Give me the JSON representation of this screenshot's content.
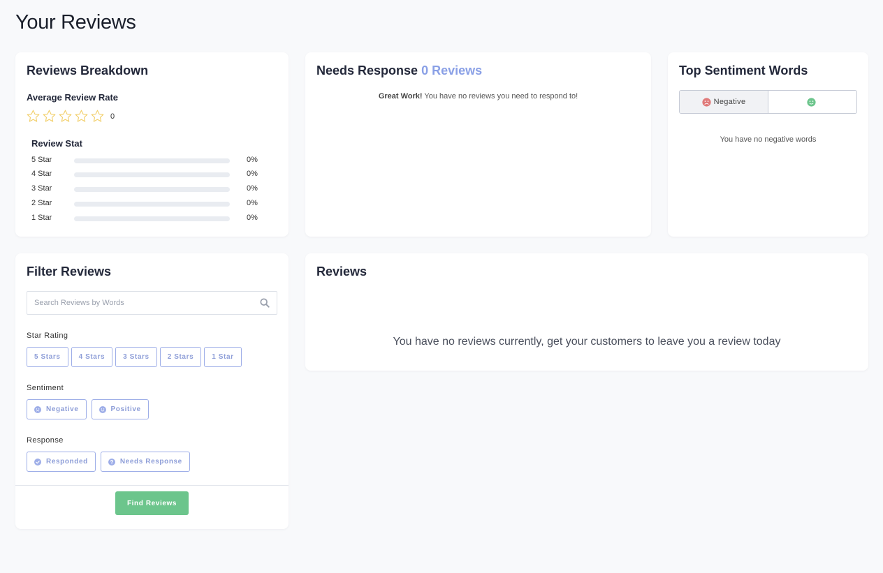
{
  "page": {
    "title": "Your Reviews"
  },
  "colors": {
    "accent": "#8aa0e6",
    "chip_border": "#9eaee8",
    "green": "#6cc58c",
    "star_outline": "#f2cf6a",
    "negative": "#e07a7a"
  },
  "breakdown": {
    "title": "Reviews Breakdown",
    "average_label": "Average Review Rate",
    "average_value": "0",
    "stars_filled": 0,
    "stars_total": 5,
    "stat_label": "Review Stat",
    "rows": [
      {
        "label": "5 Star",
        "percent": "0%",
        "fraction": 0
      },
      {
        "label": "4 Star",
        "percent": "0%",
        "fraction": 0
      },
      {
        "label": "3 Star",
        "percent": "0%",
        "fraction": 0
      },
      {
        "label": "2 Star",
        "percent": "0%",
        "fraction": 0
      },
      {
        "label": "1 Star",
        "percent": "0%",
        "fraction": 0
      }
    ]
  },
  "needs_response": {
    "title": "Needs Response",
    "count_label": "0 Reviews",
    "message_bold": "Great Work!",
    "message": " You have no reviews you need to respond to!"
  },
  "sentiment": {
    "title": "Top Sentiment Words",
    "tabs": [
      {
        "label": "Negative",
        "icon": "sad-face-icon",
        "active": true
      },
      {
        "label": "",
        "icon": "happy-face-icon",
        "active": false
      }
    ],
    "empty_message": "You have no negative words"
  },
  "filter": {
    "title": "Filter Reviews",
    "search_placeholder": "Search Reviews by Words",
    "search_value": "",
    "star_label": "Star Rating",
    "star_options": [
      "5 Stars",
      "4 Stars",
      "3 Stars",
      "2 Stars",
      "1 Star"
    ],
    "sentiment_label": "Sentiment",
    "sentiment_options": [
      {
        "label": "Negative",
        "icon": "sad-face-icon"
      },
      {
        "label": "Positive",
        "icon": "happy-face-icon"
      }
    ],
    "response_label": "Response",
    "response_options": [
      {
        "label": "Responded",
        "icon": "check-circle-icon"
      },
      {
        "label": "Needs Response",
        "icon": "question-circle-icon"
      }
    ],
    "submit_label": "Find Reviews"
  },
  "reviews": {
    "title": "Reviews",
    "empty_message": "You have no reviews currently, get your customers to leave you a review today"
  }
}
